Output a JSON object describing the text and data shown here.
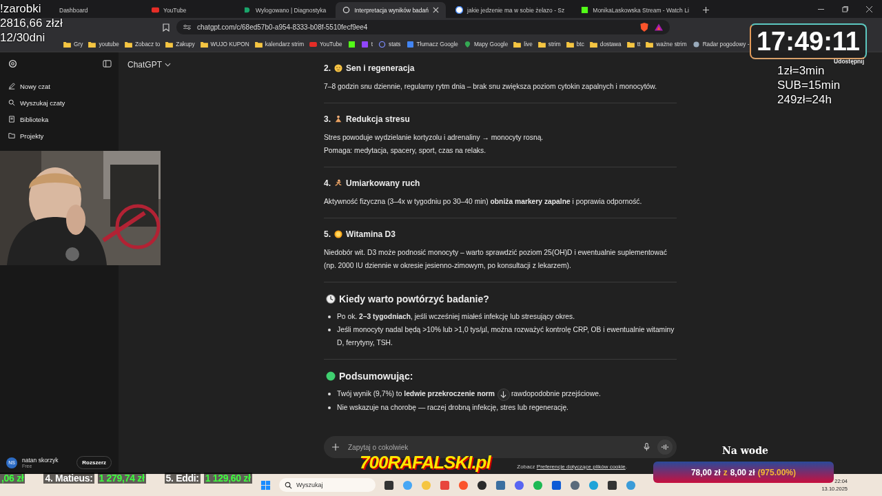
{
  "browser": {
    "tabs": [
      {
        "title": "Dashboard",
        "selected": false
      },
      {
        "title": "YouTube",
        "kind": "youtube",
        "selected": false
      },
      {
        "title": "Wylogowano | Diagnostyka",
        "kind": "diag",
        "selected": false
      },
      {
        "title": "Interpretacja wyników badań",
        "kind": "chatgpt",
        "selected": true
      },
      {
        "title": "jakie jedzenie ma w sobie żelazo - Sz",
        "kind": "google",
        "selected": false
      },
      {
        "title": "MonikaLaskowska Stream - Watch Li",
        "kind": "kick",
        "selected": false
      }
    ],
    "url": "chatgpt.com/c/68ed57b0-a954-8333-b08f-5510fecf9ee4",
    "bookmarks": [
      {
        "label": "Gry",
        "kind": "folder"
      },
      {
        "label": "youtube",
        "kind": "folder"
      },
      {
        "label": "Zobacz to",
        "kind": "folder"
      },
      {
        "label": "Zakupy",
        "kind": "folder"
      },
      {
        "label": "WUJO KUPON",
        "kind": "folder"
      },
      {
        "label": "kalendarz strim",
        "kind": "folder"
      },
      {
        "label": "YouTube",
        "kind": "youtube"
      },
      {
        "kind": "kick"
      },
      {
        "label": "t",
        "kind": "twitch"
      },
      {
        "label": "stats",
        "kind": "stats"
      },
      {
        "label": "Tłumacz Google",
        "kind": "translate"
      },
      {
        "label": "Mapy Google",
        "kind": "maps"
      },
      {
        "label": "live",
        "kind": "folder"
      },
      {
        "label": "strim",
        "kind": "folder"
      },
      {
        "label": "btc",
        "kind": "folder"
      },
      {
        "label": "dostawa",
        "kind": "folder"
      },
      {
        "label": "tt",
        "kind": "folder"
      },
      {
        "label": "ważne strim",
        "kind": "folder"
      },
      {
        "label": "Radar pogodowy -",
        "kind": "radar"
      }
    ]
  },
  "sidebar": {
    "items": [
      {
        "label": "Nowy czat",
        "kind": "edit"
      },
      {
        "label": "Wyszukaj czaty",
        "kind": "search"
      },
      {
        "label": "Biblioteka",
        "kind": "library"
      },
      {
        "label": "Projekty",
        "kind": "folder"
      }
    ],
    "user": {
      "initials": "NS",
      "name": "natan skorzyk",
      "plan": "Free",
      "button": "Rozszerz"
    }
  },
  "header": {
    "model": "ChatGPT",
    "share": "Udostępnij"
  },
  "sections": [
    {
      "number": "2.",
      "kind": "sleep",
      "title": "Sen i regeneracja",
      "paragraphs": [
        "7–8 godzin snu dziennie, regularny rytm dnia – brak snu zwiększa poziom cytokin zapalnych i monocytów."
      ]
    },
    {
      "number": "3.",
      "kind": "meditate",
      "title": "Redukcja stresu",
      "paragraphs": [
        "Stres powoduje wydzielanie kortyzolu i adrenaliny → monocyty rosną.",
        "Pomaga: medytacja, spacery, sport, czas na relaks."
      ]
    },
    {
      "number": "4.",
      "kind": "run",
      "title": "Umiarkowany ruch",
      "paragraphs": [
        "Aktywność fizyczna (3–4x w tygodniu po 30–40 min) **obniża markery zapalne** i poprawia odporność."
      ]
    },
    {
      "number": "5.",
      "kind": "sun",
      "title": "Witamina D3",
      "paragraphs": [
        "Niedobór wit. D3 może podnosić monocyty – warto sprawdzić poziom 25(OH)D i ewentualnie suplementować (np. 2000 IU dziennie w okresie jesienno-zimowym, po konsultacji z lekarzem)."
      ]
    }
  ],
  "retest": {
    "title": "Kiedy warto powtórzyć badanie?",
    "bullets": [
      "Po ok. **2–3 tygodniach**, jeśli wcześniej miałeś infekcję lub stresujący okres.",
      "Jeśli monocyty nadal będą >10% lub >1,0 tys/µl, można rozważyć kontrolę CRP, OB i ewentualnie witaminy D, ferrytyny, TSH."
    ]
  },
  "summary": {
    "title": "Podsumowując:",
    "bullets": [
      {
        "before": "Twój wynik (9,7%) to **ledwie przekroczenie norm**",
        "after": "rawdopodobnie przejściowe."
      },
      {
        "before": "Nie wskazuje na chorobę — raczej drobną infekcję, stres lub regenerację."
      }
    ]
  },
  "composer": {
    "placeholder": "Zapytaj o cokolwiek"
  },
  "footer": {
    "text": "Zobacz",
    "link": "Preferencje dotyczące plików cookie",
    "end": "."
  },
  "taskbar": {
    "search_placeholder": "Wyszukaj",
    "time": "22:04",
    "date": "13.10.2025"
  },
  "overlay": {
    "goal_lines": [
      "!zarobki",
      "2816,66 złzł",
      "12/30dni"
    ],
    "clock": "17:49:11",
    "rates": [
      "1zł=3min",
      "SUB=15min",
      "249zł=24h"
    ],
    "ticker": [
      {
        "amount": ",06 zł"
      },
      {
        "name": "4. Matieus:",
        "amount": "1 279,74 zł"
      },
      {
        "name": "5. Eddi:",
        "amount": "1 129,60 zł"
      }
    ],
    "logo": "700RAFALSKI.pl",
    "donation": {
      "title": "Na wode",
      "raised": "78,00 zł",
      "joiner": "z",
      "target": "8,00 zł",
      "percent": "(975.00%)"
    }
  }
}
